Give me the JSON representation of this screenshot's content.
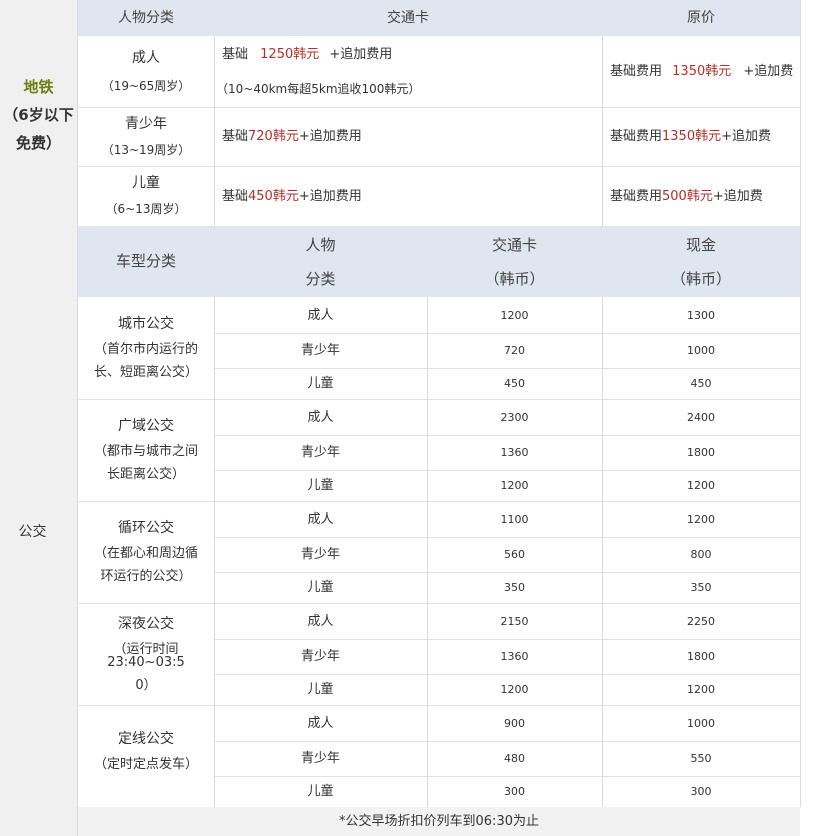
{
  "subway": {
    "label": "地铁",
    "note_line1": "（6岁以下",
    "note_line2": "免费）",
    "headers": {
      "person_type": "人物分类",
      "transit_card": "交通卡",
      "original_price": "原价"
    },
    "rows": [
      {
        "person_name": "成人",
        "person_ages": "（19~65周岁）",
        "card_prefix": "基础",
        "card_amount": "1250韩元",
        "card_suffix": "+追加费用",
        "card_note": "（10~40km每超5km追收100韩元）",
        "orig_prefix": "基础费用",
        "orig_amount": "1350韩元",
        "orig_suffix": "+追加费"
      },
      {
        "person_name": "青少年",
        "person_ages": "（13~19周岁）",
        "card_prefix": "基础",
        "card_amount": "720韩元",
        "card_suffix": "+追加费用",
        "orig_prefix": "基础费用",
        "orig_amount": "1350韩元",
        "orig_suffix": "+追加费"
      },
      {
        "person_name": "儿童",
        "person_ages": "（6~13周岁）",
        "card_prefix": "基础",
        "card_amount": "450韩元",
        "card_suffix": "+追加费用",
        "orig_prefix": "基础费用",
        "orig_amount": "500韩元",
        "orig_suffix": "+追加费"
      }
    ]
  },
  "bus": {
    "label": "公交",
    "headers": {
      "vehicle_type": "车型分类",
      "person_type_l1": "人物",
      "person_type_l2": "分类",
      "transit_card_l1": "交通卡",
      "transit_card_l2": "（韩币）",
      "cash_l1": "现金",
      "cash_l2": "（韩币）"
    },
    "groups": [
      {
        "name": "城市公交",
        "desc_line1": "（首尔市内运行的",
        "desc_line2": "长、短距离公交）",
        "rows": [
          {
            "person": "成人",
            "card": "1200",
            "cash": "1300"
          },
          {
            "person": "青少年",
            "card": "720",
            "cash": "1000"
          },
          {
            "person": "儿童",
            "card": "450",
            "cash": "450"
          }
        ]
      },
      {
        "name": "广域公交",
        "desc_line1": "（都市与城市之间",
        "desc_line2": "长距离公交）",
        "rows": [
          {
            "person": "成人",
            "card": "2300",
            "cash": "2400"
          },
          {
            "person": "青少年",
            "card": "1360",
            "cash": "1800"
          },
          {
            "person": "儿童",
            "card": "1200",
            "cash": "1200"
          }
        ]
      },
      {
        "name": "循环公交",
        "desc_line1": "（在都心和周边循",
        "desc_line2": "环运行的公交）",
        "rows": [
          {
            "person": "成人",
            "card": "1100",
            "cash": "1200"
          },
          {
            "person": "青少年",
            "card": "560",
            "cash": "800"
          },
          {
            "person": "儿童",
            "card": "350",
            "cash": "350"
          }
        ]
      },
      {
        "name": "深夜公交",
        "desc_line1": "（运行时间23:40~03:5",
        "desc_line2": "0）",
        "rows": [
          {
            "person": "成人",
            "card": "2150",
            "cash": "2250"
          },
          {
            "person": "青少年",
            "card": "1360",
            "cash": "1800"
          },
          {
            "person": "儿童",
            "card": "1200",
            "cash": "1200"
          }
        ]
      },
      {
        "name": "定线公交",
        "desc_line1": "（定时定点发车）",
        "desc_line2": "",
        "rows": [
          {
            "person": "成人",
            "card": "900",
            "cash": "1000"
          },
          {
            "person": "青少年",
            "card": "480",
            "cash": "550"
          },
          {
            "person": "儿童",
            "card": "300",
            "cash": "300"
          }
        ]
      }
    ],
    "footnote": "*公交早场折扣价列车到06:30为止"
  }
}
